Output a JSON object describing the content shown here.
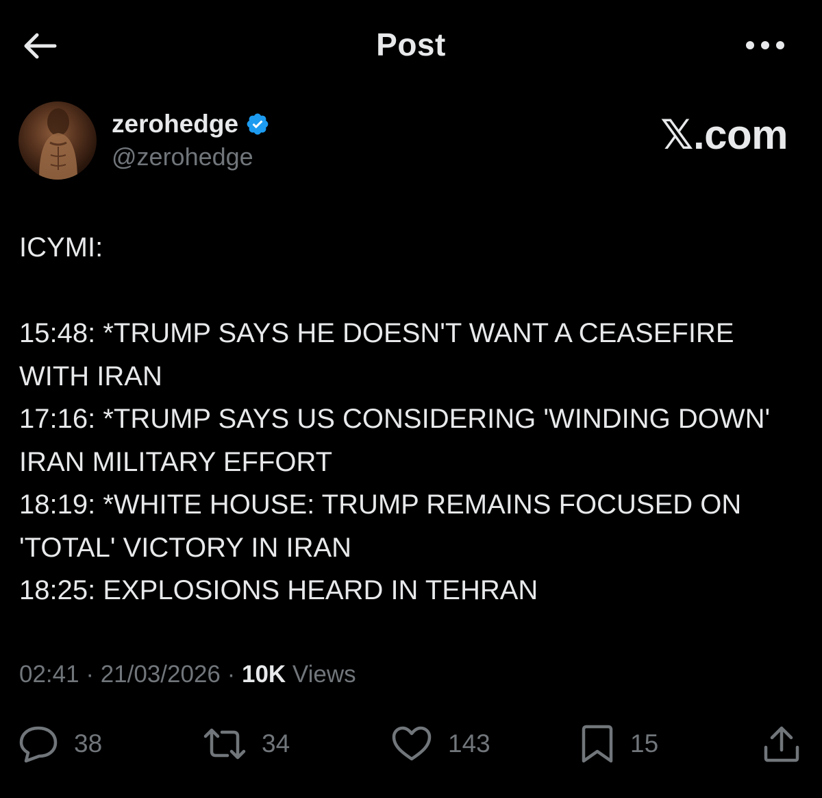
{
  "header": {
    "title": "Post",
    "back_icon": "arrow-left-icon",
    "more_icon": "more-horizontal-icon"
  },
  "author": {
    "display_name": "zerohedge",
    "handle": "@zerohedge",
    "verified_color": "#1d9bf0"
  },
  "brand": "𝕏.com",
  "post": {
    "text": "ICYMI:\n\n15:48: *TRUMP SAYS HE DOESN'T WANT A CEASEFIRE WITH IRAN\n17:16: *TRUMP SAYS US CONSIDERING 'WINDING DOWN' IRAN MILITARY EFFORT\n18:19: *WHITE HOUSE: TRUMP REMAINS FOCUSED ON 'TOTAL' VICTORY IN IRAN\n18:25: EXPLOSIONS HEARD IN TEHRAN"
  },
  "meta": {
    "time": "02:41",
    "separator": " · ",
    "date": "21/03/2026",
    "views_count": "10K",
    "views_label": " Views"
  },
  "actions": {
    "replies": "38",
    "reposts": "34",
    "likes": "143",
    "bookmarks": "15"
  },
  "colors": {
    "background": "#000000",
    "text": "#e7e9ea",
    "secondary": "#71767b",
    "accent": "#1d9bf0"
  }
}
